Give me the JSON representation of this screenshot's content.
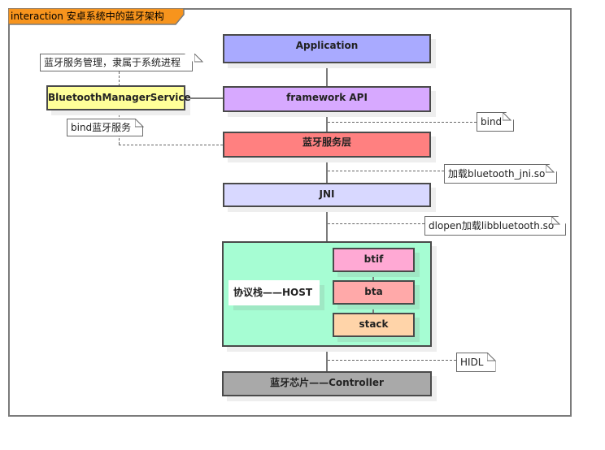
{
  "diagram": {
    "title": "interaction 安卓系统中的蓝牙架构",
    "layers": [
      {
        "id": "application",
        "label": "Application",
        "color": "#a9aaff"
      },
      {
        "id": "framework-api",
        "label": "framework API",
        "color": "#d7a9ff"
      },
      {
        "id": "bluetooth-service-layer",
        "label": "蓝牙服务层",
        "color": "#ff8080"
      },
      {
        "id": "jni",
        "label": "JNI",
        "color": "#d8d8ff"
      },
      {
        "id": "host",
        "label": "协议栈——HOST",
        "color": "#a6fdd3"
      },
      {
        "id": "controller",
        "label": "蓝牙芯片——Controller",
        "color": "#a9a9a9"
      }
    ],
    "host_components": [
      {
        "id": "btif",
        "label": "btif",
        "color": "#ffa9d4"
      },
      {
        "id": "bta",
        "label": "bta",
        "color": "#ffa9a9"
      },
      {
        "id": "stack",
        "label": "stack",
        "color": "#ffd4a9"
      }
    ],
    "manager_service": {
      "label": "BluetoothManagerService",
      "color": "#ffff99"
    },
    "notes": {
      "manager_desc": "蓝牙服务管理，隶属于系统进程",
      "bind_service": "bind蓝牙服务",
      "bind": "bind",
      "load_jni": "加载bluetooth_jni.so",
      "dlopen": "dlopen加载libbluetooth.so",
      "hidl": "HIDL"
    },
    "colors": {
      "title_tab": "#f7941d",
      "frame_border": "#7b7b7b",
      "box_border": "#4a4a4a"
    }
  }
}
